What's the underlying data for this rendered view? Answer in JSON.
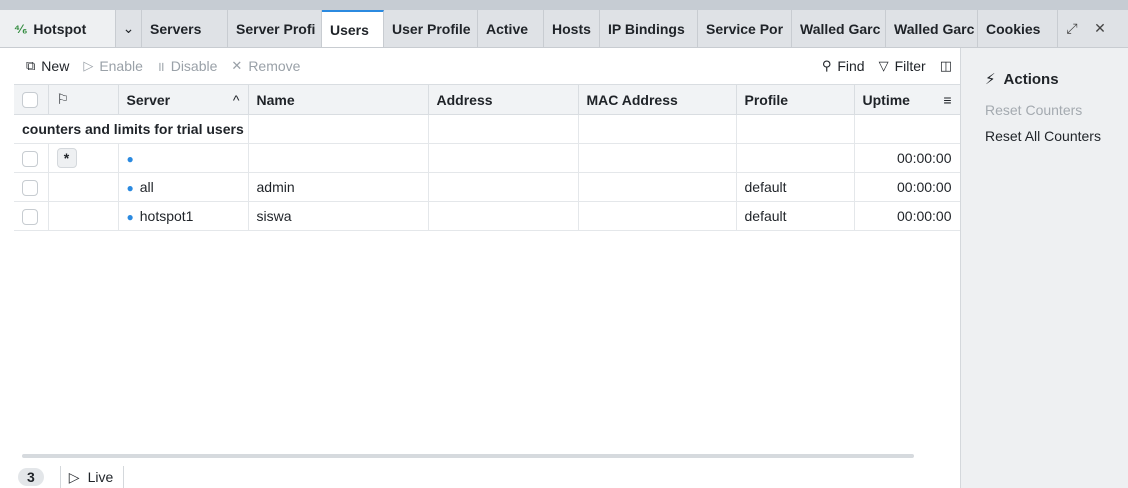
{
  "window": {
    "title": "Hotspot",
    "tabs": [
      {
        "label": "Servers",
        "active": false
      },
      {
        "label": "Server Profi",
        "active": false
      },
      {
        "label": "Users",
        "active": true
      },
      {
        "label": "User Profile",
        "active": false
      },
      {
        "label": "Active",
        "active": false
      },
      {
        "label": "Hosts",
        "active": false
      },
      {
        "label": "IP Bindings",
        "active": false
      },
      {
        "label": "Service Por",
        "active": false
      },
      {
        "label": "Walled Garc",
        "active": false
      },
      {
        "label": "Walled Garc",
        "active": false
      },
      {
        "label": "Cookies",
        "active": false
      }
    ]
  },
  "toolbar": {
    "new_label": "New",
    "enable_label": "Enable",
    "disable_label": "Disable",
    "remove_label": "Remove",
    "find_label": "Find",
    "filter_label": "Filter"
  },
  "table": {
    "columns": [
      "Server",
      "Name",
      "Address",
      "MAC Address",
      "Profile",
      "Uptime"
    ],
    "comment": "counters and limits for trial users",
    "rows": [
      {
        "flag": "*",
        "server": "",
        "name": "",
        "address": "",
        "mac": "",
        "profile": "",
        "uptime": "00:00:00"
      },
      {
        "flag": "",
        "server": "all",
        "name": "admin",
        "address": "",
        "mac": "",
        "profile": "default",
        "uptime": "00:00:00"
      },
      {
        "flag": "",
        "server": "hotspot1",
        "name": "siswa",
        "address": "",
        "mac": "",
        "profile": "default",
        "uptime": "00:00:00"
      }
    ]
  },
  "status": {
    "count": "3",
    "live_label": "Live"
  },
  "actions": {
    "title": "Actions",
    "items": [
      {
        "label": "Reset Counters",
        "enabled": false
      },
      {
        "label": "Reset All Counters",
        "enabled": true
      }
    ]
  },
  "colors": {
    "accent": "#2b8ae0",
    "tabbar_bg": "#dfe2e6",
    "actions_bg": "#eef0f2"
  }
}
